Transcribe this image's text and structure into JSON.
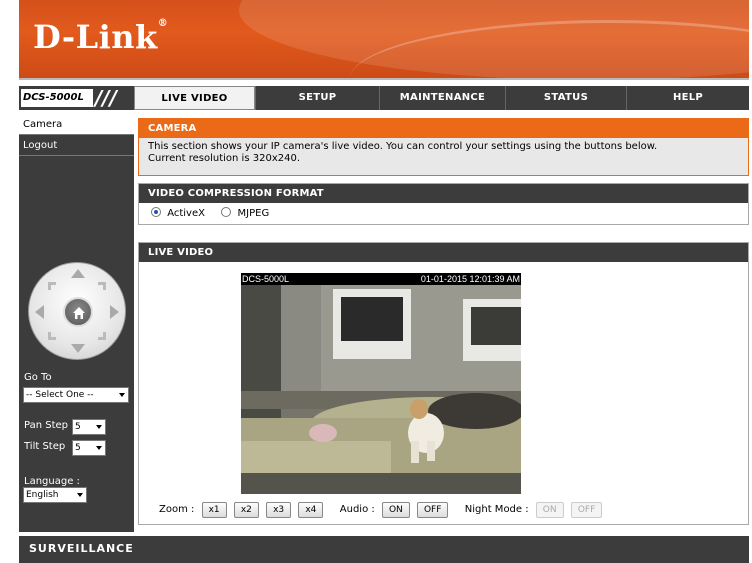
{
  "brand": {
    "logo": "D-Link",
    "model": "DCS-5000L",
    "slashes": "///"
  },
  "nav": {
    "tabs": [
      {
        "label": "LIVE VIDEO"
      },
      {
        "label": "SETUP"
      },
      {
        "label": "MAINTENANCE"
      },
      {
        "label": "STATUS"
      },
      {
        "label": "HELP"
      }
    ]
  },
  "sidebar": {
    "items": [
      {
        "label": "Camera"
      },
      {
        "label": "Logout"
      }
    ],
    "goto_label": "Go To",
    "goto_value": "-- Select One --",
    "pan_step_label": "Pan Step",
    "pan_step_value": "5",
    "tilt_step_label": "Tilt Step",
    "tilt_step_value": "5",
    "language_label": "Language :",
    "language_value": "English"
  },
  "camera": {
    "title": "CAMERA",
    "desc_line1": "This section shows your IP camera's live video. You can control your settings using the buttons below.",
    "desc_line2": "Current resolution is 320x240."
  },
  "compression": {
    "title": "VIDEO COMPRESSION FORMAT",
    "options": [
      {
        "label": "ActiveX",
        "selected": true
      },
      {
        "label": "MJPEG",
        "selected": false
      }
    ]
  },
  "live": {
    "title": "LIVE VIDEO",
    "osd_name": "DCS-5000L",
    "osd_timestamp": "01-01-2015 12:01:39 AM",
    "zoom_label": "Zoom :",
    "zoom_buttons": [
      "x1",
      "x2",
      "x3",
      "x4"
    ],
    "audio_label": "Audio :",
    "audio_on": "ON",
    "audio_off": "OFF",
    "night_label": "Night Mode :",
    "night_on": "ON",
    "night_off": "OFF"
  },
  "footer": {
    "text": "SURVEILLANCE"
  },
  "colors": {
    "orange": "#ea6a17",
    "dark": "#3c3c3c",
    "header": "#d4511b"
  }
}
